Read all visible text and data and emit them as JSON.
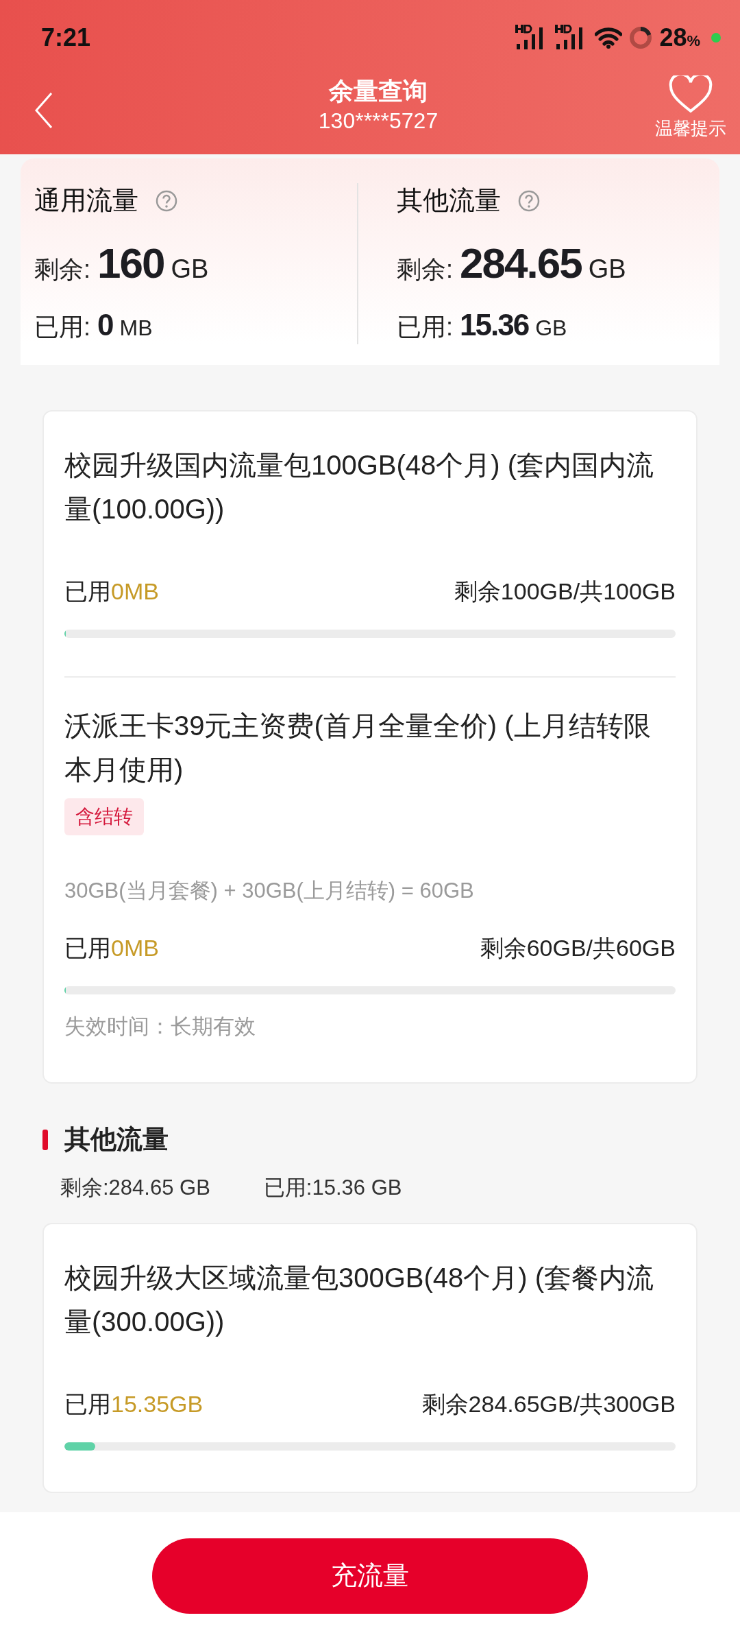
{
  "status_bar": {
    "time": "7:21",
    "battery": "28",
    "battery_unit": "%"
  },
  "header": {
    "title": "余量查询",
    "phone": "130****5727",
    "tip_label": "温馨提示"
  },
  "summary": [
    {
      "title": "通用流量",
      "remaining_label": "剩余:",
      "remaining_value": "160",
      "remaining_unit": "GB",
      "used_label": "已用:",
      "used_value": "0",
      "used_unit": "MB"
    },
    {
      "title": "其他流量",
      "remaining_label": "剩余:",
      "remaining_value": "284.65",
      "remaining_unit": "GB",
      "used_label": "已用:",
      "used_value": "15.36",
      "used_unit": "GB"
    }
  ],
  "general_packages": [
    {
      "name": "校园升级国内流量包100GB(48个月) (套内国内流量(100.00G))",
      "used_label": "已用",
      "used_value": "0MB",
      "balance": "剩余100GB/共100GB",
      "level": 0
    },
    {
      "name": "沃派王卡39元主资费(首月全量全价) (上月结转限本月使用)",
      "tag": "含结转",
      "formula": "30GB(当月套餐) + 30GB(上月结转) = 60GB",
      "used_label": "已用",
      "used_value": "0MB",
      "balance": "剩余60GB/共60GB",
      "level": 0,
      "expiry": "失效时间：长期有效"
    }
  ],
  "other_section": {
    "title": "其他流量",
    "remaining": "剩余:284.65 GB",
    "used": "已用:15.36 GB"
  },
  "other_packages": [
    {
      "name": "校园升级大区域流量包300GB(48个月) (套餐内流量(300.00G))",
      "used_label": "已用",
      "used_value": "15.35GB",
      "balance": "剩余284.65GB/共300GB",
      "level": 0.05
    }
  ],
  "action_button": "充流量"
}
